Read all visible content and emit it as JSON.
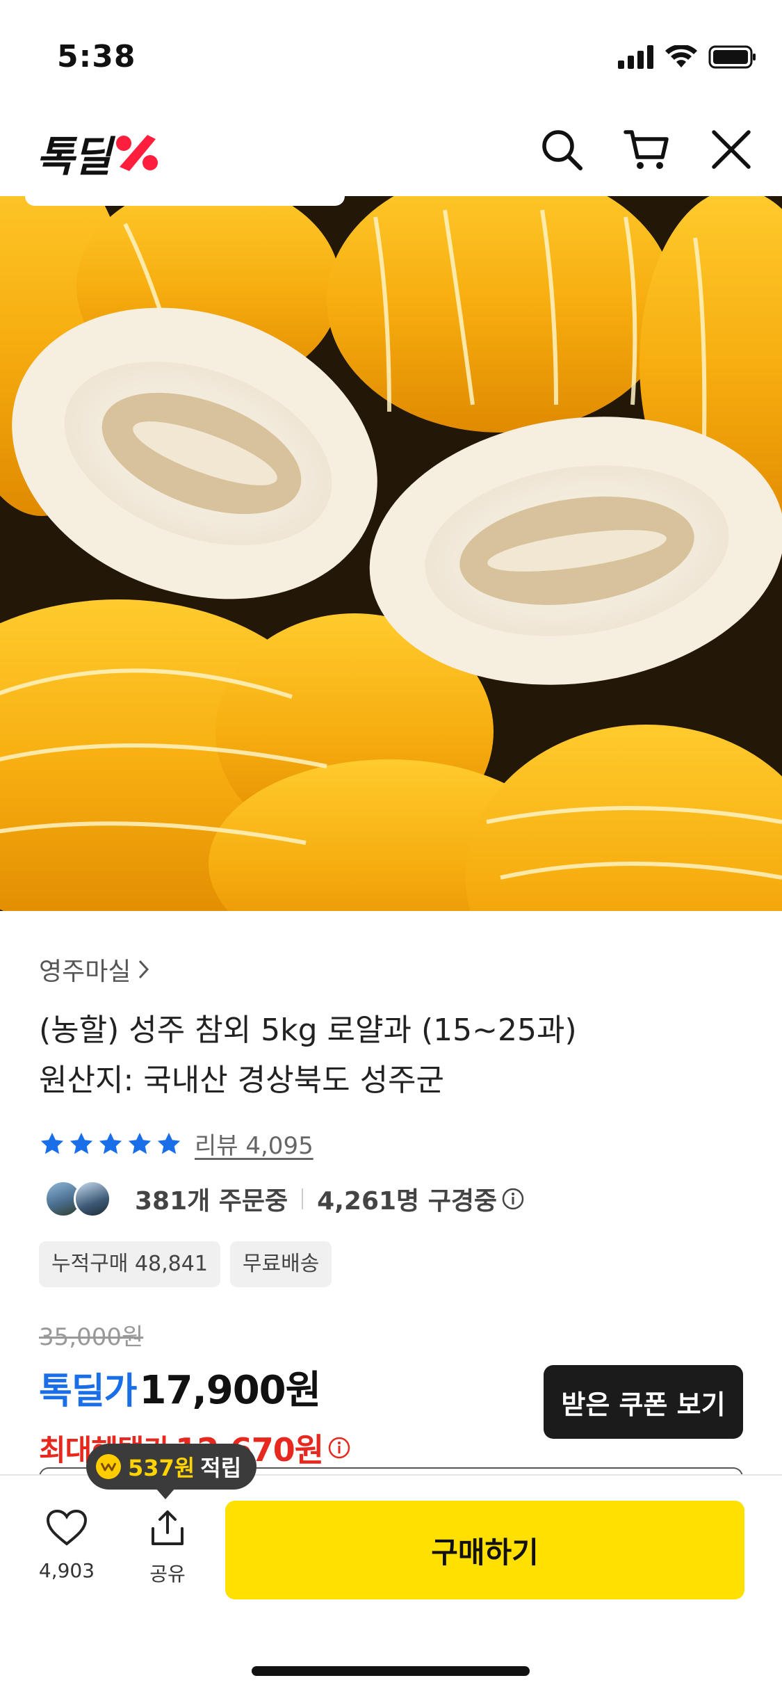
{
  "status": {
    "time": "5:38"
  },
  "header": {
    "logo": "톡딜"
  },
  "product": {
    "seller": "영주마실",
    "title_line1": "(농할) 성주 참외 5kg 로얄과 (15~25과)",
    "title_line2": "원산지: 국내산 경상북도 성주군",
    "rating_stars": 5,
    "review_link": "리뷰 4,095",
    "ordering": "381개 주문중",
    "browsing": "4,261명 구경중",
    "badges": [
      "누적구매 48,841",
      "무료배송"
    ]
  },
  "price": {
    "original": "35,000원",
    "deal_label": "톡딜가",
    "deal_value": "17,900원",
    "benefit_label": "최대혜택가",
    "benefit_value": "12,670원"
  },
  "coupon_button": "받은 쿠폰 보기",
  "bottom_bar": {
    "like_count": "4,903",
    "share_label": "공유",
    "buy_label": "구매하기",
    "point_amount": "537원",
    "point_suffix": "적립"
  },
  "colors": {
    "accent_blue": "#1a6fe8",
    "accent_red": "#e6281e",
    "buy_yellow": "#ffe000",
    "star_blue": "#1a6fe8"
  }
}
